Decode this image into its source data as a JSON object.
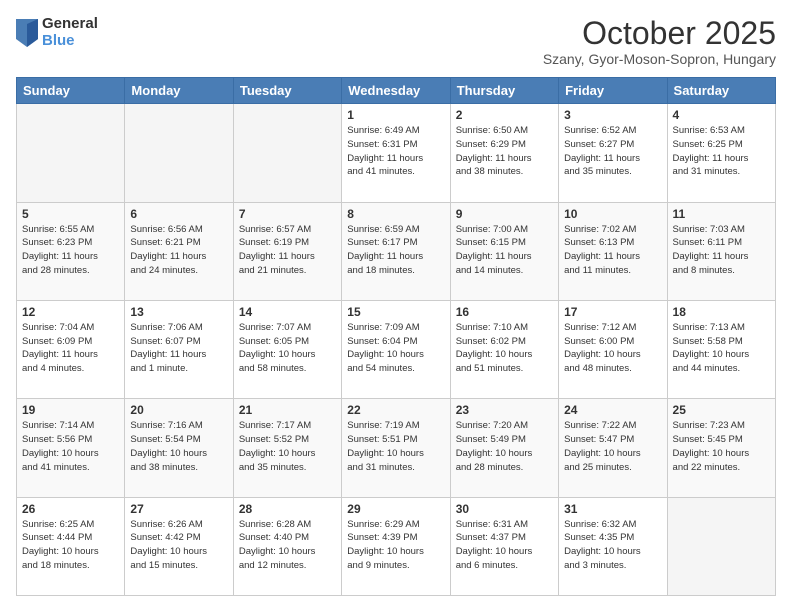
{
  "logo": {
    "general": "General",
    "blue": "Blue"
  },
  "header": {
    "title": "October 2025",
    "subtitle": "Szany, Gyor-Moson-Sopron, Hungary"
  },
  "days_of_week": [
    "Sunday",
    "Monday",
    "Tuesday",
    "Wednesday",
    "Thursday",
    "Friday",
    "Saturday"
  ],
  "weeks": [
    [
      {
        "day": "",
        "info": ""
      },
      {
        "day": "",
        "info": ""
      },
      {
        "day": "",
        "info": ""
      },
      {
        "day": "1",
        "info": "Sunrise: 6:49 AM\nSunset: 6:31 PM\nDaylight: 11 hours\nand 41 minutes."
      },
      {
        "day": "2",
        "info": "Sunrise: 6:50 AM\nSunset: 6:29 PM\nDaylight: 11 hours\nand 38 minutes."
      },
      {
        "day": "3",
        "info": "Sunrise: 6:52 AM\nSunset: 6:27 PM\nDaylight: 11 hours\nand 35 minutes."
      },
      {
        "day": "4",
        "info": "Sunrise: 6:53 AM\nSunset: 6:25 PM\nDaylight: 11 hours\nand 31 minutes."
      }
    ],
    [
      {
        "day": "5",
        "info": "Sunrise: 6:55 AM\nSunset: 6:23 PM\nDaylight: 11 hours\nand 28 minutes."
      },
      {
        "day": "6",
        "info": "Sunrise: 6:56 AM\nSunset: 6:21 PM\nDaylight: 11 hours\nand 24 minutes."
      },
      {
        "day": "7",
        "info": "Sunrise: 6:57 AM\nSunset: 6:19 PM\nDaylight: 11 hours\nand 21 minutes."
      },
      {
        "day": "8",
        "info": "Sunrise: 6:59 AM\nSunset: 6:17 PM\nDaylight: 11 hours\nand 18 minutes."
      },
      {
        "day": "9",
        "info": "Sunrise: 7:00 AM\nSunset: 6:15 PM\nDaylight: 11 hours\nand 14 minutes."
      },
      {
        "day": "10",
        "info": "Sunrise: 7:02 AM\nSunset: 6:13 PM\nDaylight: 11 hours\nand 11 minutes."
      },
      {
        "day": "11",
        "info": "Sunrise: 7:03 AM\nSunset: 6:11 PM\nDaylight: 11 hours\nand 8 minutes."
      }
    ],
    [
      {
        "day": "12",
        "info": "Sunrise: 7:04 AM\nSunset: 6:09 PM\nDaylight: 11 hours\nand 4 minutes."
      },
      {
        "day": "13",
        "info": "Sunrise: 7:06 AM\nSunset: 6:07 PM\nDaylight: 11 hours\nand 1 minute."
      },
      {
        "day": "14",
        "info": "Sunrise: 7:07 AM\nSunset: 6:05 PM\nDaylight: 10 hours\nand 58 minutes."
      },
      {
        "day": "15",
        "info": "Sunrise: 7:09 AM\nSunset: 6:04 PM\nDaylight: 10 hours\nand 54 minutes."
      },
      {
        "day": "16",
        "info": "Sunrise: 7:10 AM\nSunset: 6:02 PM\nDaylight: 10 hours\nand 51 minutes."
      },
      {
        "day": "17",
        "info": "Sunrise: 7:12 AM\nSunset: 6:00 PM\nDaylight: 10 hours\nand 48 minutes."
      },
      {
        "day": "18",
        "info": "Sunrise: 7:13 AM\nSunset: 5:58 PM\nDaylight: 10 hours\nand 44 minutes."
      }
    ],
    [
      {
        "day": "19",
        "info": "Sunrise: 7:14 AM\nSunset: 5:56 PM\nDaylight: 10 hours\nand 41 minutes."
      },
      {
        "day": "20",
        "info": "Sunrise: 7:16 AM\nSunset: 5:54 PM\nDaylight: 10 hours\nand 38 minutes."
      },
      {
        "day": "21",
        "info": "Sunrise: 7:17 AM\nSunset: 5:52 PM\nDaylight: 10 hours\nand 35 minutes."
      },
      {
        "day": "22",
        "info": "Sunrise: 7:19 AM\nSunset: 5:51 PM\nDaylight: 10 hours\nand 31 minutes."
      },
      {
        "day": "23",
        "info": "Sunrise: 7:20 AM\nSunset: 5:49 PM\nDaylight: 10 hours\nand 28 minutes."
      },
      {
        "day": "24",
        "info": "Sunrise: 7:22 AM\nSunset: 5:47 PM\nDaylight: 10 hours\nand 25 minutes."
      },
      {
        "day": "25",
        "info": "Sunrise: 7:23 AM\nSunset: 5:45 PM\nDaylight: 10 hours\nand 22 minutes."
      }
    ],
    [
      {
        "day": "26",
        "info": "Sunrise: 6:25 AM\nSunset: 4:44 PM\nDaylight: 10 hours\nand 18 minutes."
      },
      {
        "day": "27",
        "info": "Sunrise: 6:26 AM\nSunset: 4:42 PM\nDaylight: 10 hours\nand 15 minutes."
      },
      {
        "day": "28",
        "info": "Sunrise: 6:28 AM\nSunset: 4:40 PM\nDaylight: 10 hours\nand 12 minutes."
      },
      {
        "day": "29",
        "info": "Sunrise: 6:29 AM\nSunset: 4:39 PM\nDaylight: 10 hours\nand 9 minutes."
      },
      {
        "day": "30",
        "info": "Sunrise: 6:31 AM\nSunset: 4:37 PM\nDaylight: 10 hours\nand 6 minutes."
      },
      {
        "day": "31",
        "info": "Sunrise: 6:32 AM\nSunset: 4:35 PM\nDaylight: 10 hours\nand 3 minutes."
      },
      {
        "day": "",
        "info": ""
      }
    ]
  ]
}
